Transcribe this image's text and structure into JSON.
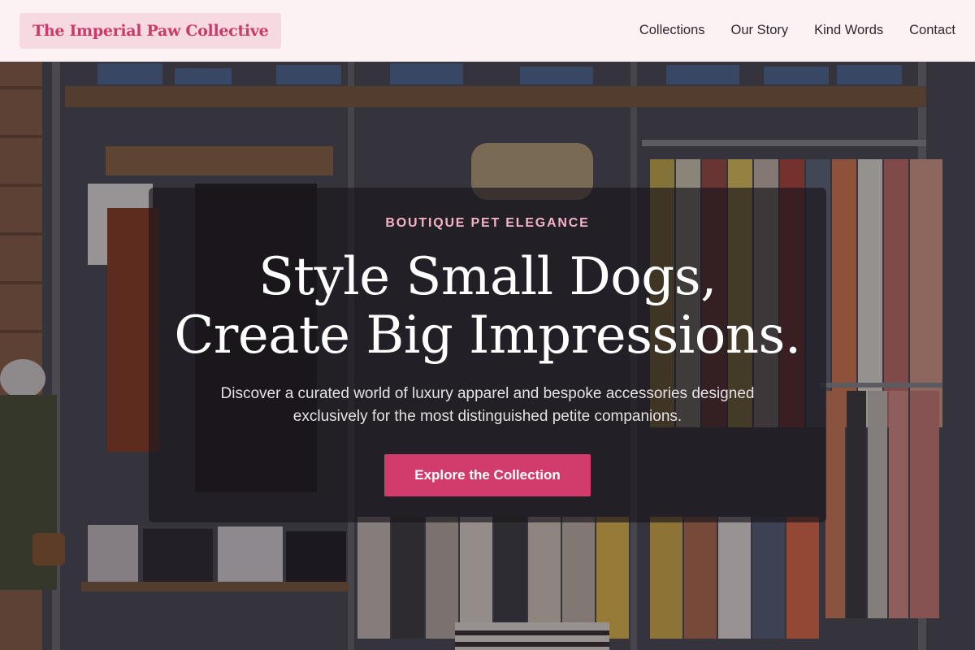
{
  "brand": {
    "name": "The Imperial Paw Collective"
  },
  "nav": {
    "items": [
      {
        "label": "Collections"
      },
      {
        "label": "Our Story"
      },
      {
        "label": "Kind Words"
      },
      {
        "label": "Contact"
      }
    ]
  },
  "hero": {
    "eyebrow": "BOUTIQUE PET ELEGANCE",
    "headline_line1": "Style Small Dogs,",
    "headline_line2": "Create Big Impressions.",
    "subtext": "Discover a curated world of luxury apparel and bespoke accessories designed exclusively for the most distinguished petite companions.",
    "cta_label": "Explore the Collection"
  },
  "colors": {
    "accent": "#d23c6c",
    "eyebrow": "#f4b3c8",
    "header_bg": "#fdf2f3",
    "brand_bg": "#f7d9e1",
    "brand_text": "#c93a6b"
  }
}
